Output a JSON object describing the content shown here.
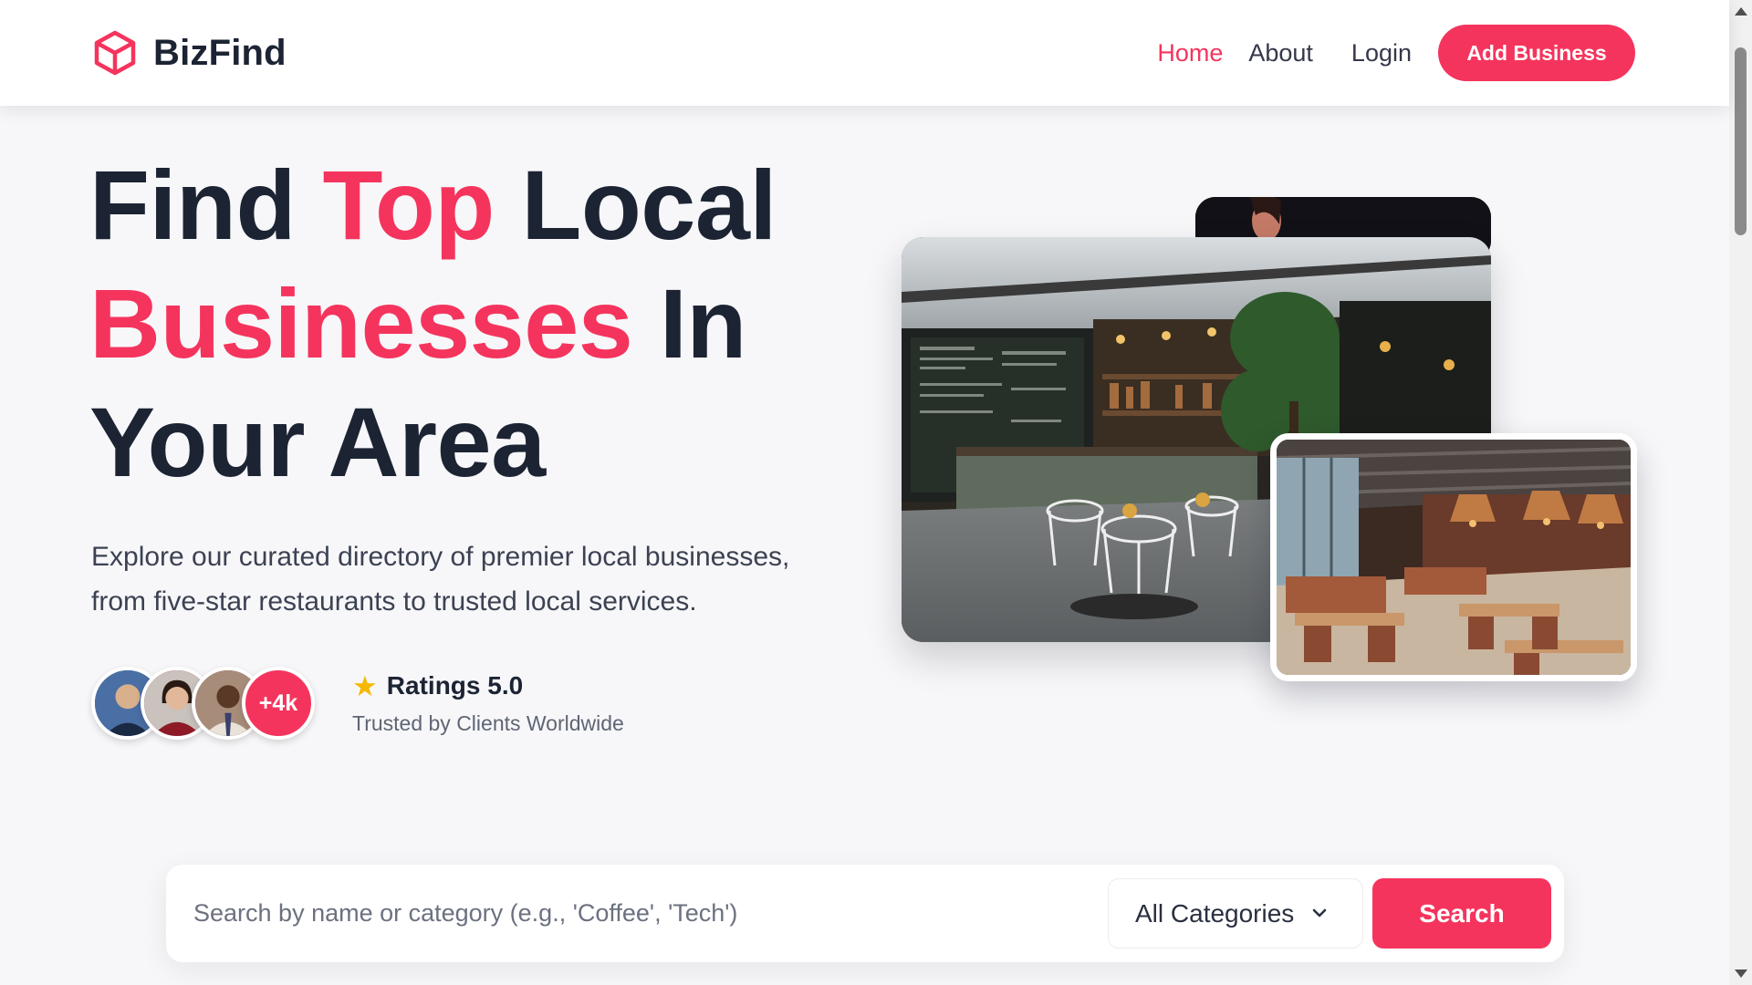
{
  "brand": {
    "name": "BizFind",
    "logo_icon": "cube-icon",
    "accent_color": "#f5345d"
  },
  "nav": {
    "home": "Home",
    "about": "About",
    "login": "Login",
    "add_business": "Add Business"
  },
  "hero": {
    "title_find": "Find",
    "title_top": "Top",
    "title_local": "Local",
    "title_businesses": "Businesses",
    "title_in": "In",
    "title_your_area": "Your Area",
    "description": "Explore our curated directory of premier local businesses, from five-star restaurants to trusted local services."
  },
  "social_proof": {
    "more_count": "+4k",
    "rating_label": "Ratings 5.0",
    "rating_subtext": "Trusted by Clients Worldwide",
    "star_icon": "star-icon",
    "star_color": "#f6b800"
  },
  "search": {
    "placeholder": "Search by name or category (e.g., 'Coffee', 'Tech')",
    "category_selected": "All Categories",
    "button": "Search"
  }
}
